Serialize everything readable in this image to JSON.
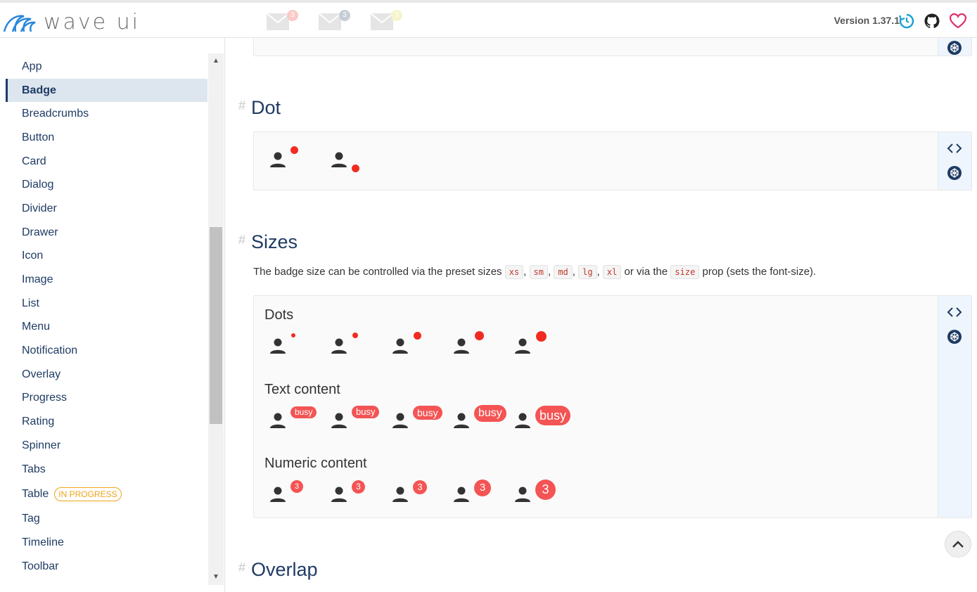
{
  "app": {
    "name": "wave ui",
    "version": "Version 1.37.1"
  },
  "colors": {
    "primary": "#1f3b64",
    "badge": "#f45454",
    "dot": "#f22b22",
    "warning": "#f0a21a"
  },
  "sidebar": {
    "items": [
      {
        "label": "App"
      },
      {
        "label": "Badge",
        "active": true
      },
      {
        "label": "Breadcrumbs"
      },
      {
        "label": "Button"
      },
      {
        "label": "Card"
      },
      {
        "label": "Dialog"
      },
      {
        "label": "Divider"
      },
      {
        "label": "Drawer"
      },
      {
        "label": "Icon"
      },
      {
        "label": "Image"
      },
      {
        "label": "List"
      },
      {
        "label": "Menu"
      },
      {
        "label": "Notification"
      },
      {
        "label": "Overlay"
      },
      {
        "label": "Progress"
      },
      {
        "label": "Rating"
      },
      {
        "label": "Spinner"
      },
      {
        "label": "Tabs"
      },
      {
        "label": "Table",
        "tag": "IN PROGRESS"
      },
      {
        "label": "Tag"
      },
      {
        "label": "Timeline"
      },
      {
        "label": "Toolbar"
      }
    ]
  },
  "ghost_badges": [
    "3",
    "3",
    "3"
  ],
  "sections": {
    "dot": {
      "hash": "#",
      "title": "Dot"
    },
    "sizes": {
      "hash": "#",
      "title": "Sizes",
      "desc_before": "The badge size can be controlled via the preset sizes",
      "sizes": [
        "xs",
        "sm",
        "md",
        "lg",
        "xl"
      ],
      "desc_mid": "or via the",
      "prop": "size",
      "desc_after": "prop (sets the font-size).",
      "dots_title": "Dots",
      "text_title": "Text content",
      "text_badge": "busy",
      "numeric_title": "Numeric content",
      "numeric_badge": "3"
    },
    "overlap": {
      "hash": "#",
      "title": "Overlap"
    }
  }
}
